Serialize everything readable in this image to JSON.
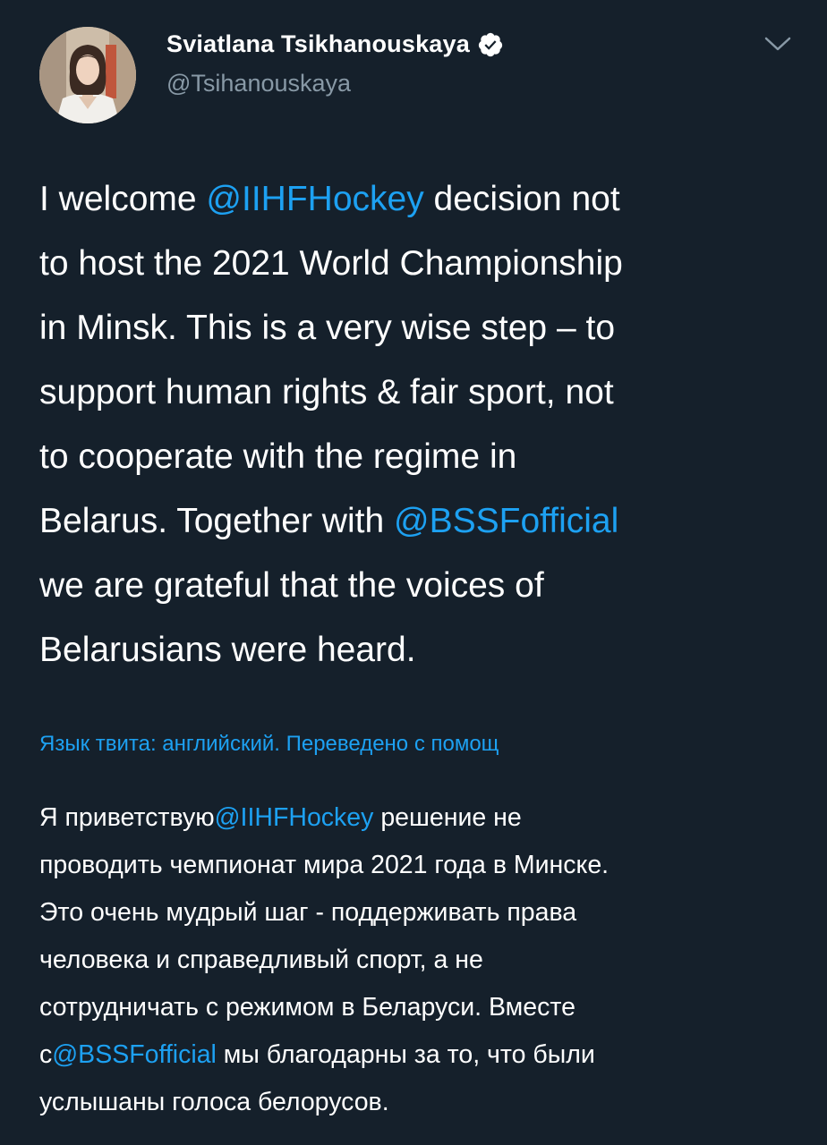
{
  "author": {
    "display_name": "Sviatlana Tsikhanouskaya",
    "handle": "@Tsihanouskaya",
    "verified_icon": "verified-badge-icon",
    "avatar_icon": "profile-photo"
  },
  "menu": {
    "chevron_icon": "chevron-down-icon"
  },
  "tweet": {
    "l1_pre": "I welcome ",
    "l1_mention": "@IIHFHockey",
    "l1_post": " decision not",
    "l2": "to host the 2021 World Championship",
    "l3": "in Minsk. This is a very wise step – to",
    "l4": "support human rights & fair sport, not",
    "l5": "to cooperate with the regime in",
    "l6_pre": "Belarus. Together with ",
    "l6_mention": "@BSSFofficial",
    "l7": "we are grateful that the voices of",
    "l8": "Belarusians were heard."
  },
  "translate_note": "Язык твита: английский. Переведено с помощ",
  "translation": {
    "l1_pre": "Я приветствую",
    "l1_mention": "@IIHFHockey",
    "l1_post": " решение не",
    "l2": "проводить чемпионат мира 2021 года в Минске.",
    "l3": "Это очень мудрый шаг - поддерживать права",
    "l4": "человека и справедливый спорт, а не",
    "l5": "сотрудничать с режимом в Беларуси. Вместе",
    "l6_pre": "с",
    "l6_mention": "@BSSFofficial",
    "l6_post": " мы благодарны за то, что были",
    "l7": "услышаны голоса белорусов."
  },
  "colors": {
    "background": "#15202b",
    "text": "#ffffff",
    "secondary_text": "#8899a6",
    "accent": "#1da1f2"
  }
}
